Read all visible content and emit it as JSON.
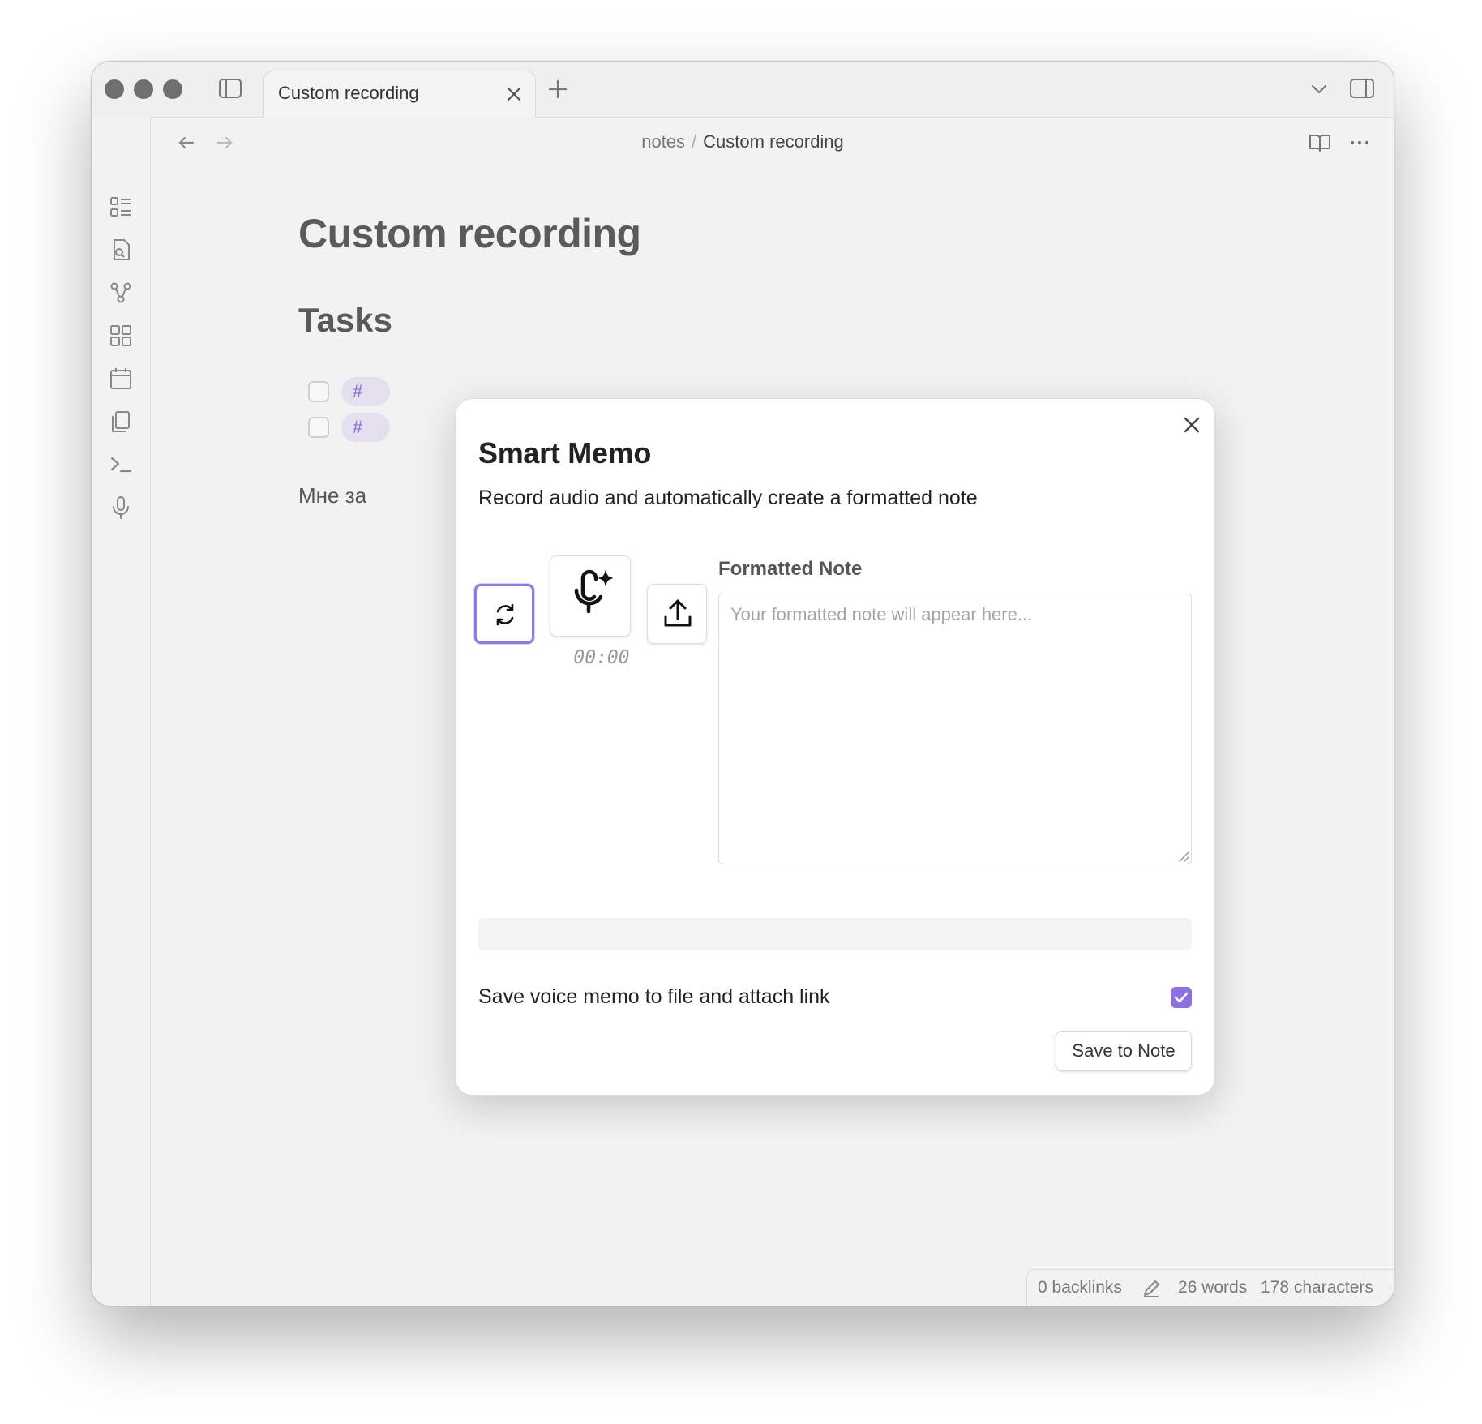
{
  "tabs": [
    {
      "label": "Custom recording"
    }
  ],
  "breadcrumb": {
    "folder": "notes",
    "separator": "/",
    "current": "Custom recording"
  },
  "document": {
    "title": "Custom recording",
    "heading": "Tasks",
    "tag_prefix": "#",
    "body_text_visible": "Мне за"
  },
  "modal": {
    "title": "Smart Memo",
    "subtitle": "Record audio and automatically create a formatted note",
    "timer": "00:00",
    "formatted_note_label": "Formatted Note",
    "formatted_note_placeholder": "Your formatted note will appear here...",
    "formatted_note_value": "",
    "save_voice_memo_label": "Save voice memo to file and attach link",
    "save_voice_memo_checked": true,
    "save_button": "Save to Note"
  },
  "statusbar": {
    "backlinks": "0 backlinks",
    "words": "26 words",
    "characters": "178 characters"
  },
  "colors": {
    "accent": "#8c6fe0",
    "window_bg": "#f2f2f2",
    "modal_bg": "#ffffff"
  },
  "icons": {
    "ribbon": [
      "file-list-icon",
      "file-search-icon",
      "graph-icon",
      "blocks-icon",
      "calendar-icon",
      "copy-icon",
      "terminal-icon",
      "microphone-icon"
    ],
    "modal_controls": [
      "refresh-icon",
      "mic-sparkle-icon",
      "upload-icon"
    ]
  }
}
